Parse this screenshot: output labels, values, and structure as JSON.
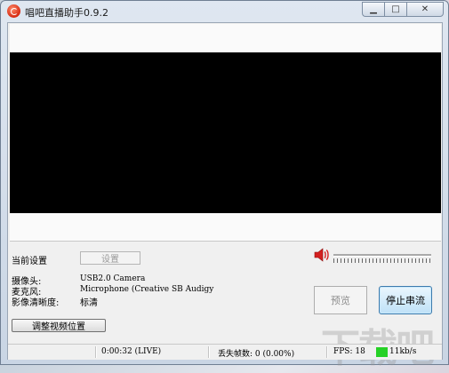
{
  "window": {
    "title": "唱吧直播助手0.9.2",
    "minimize_glyph": "▁",
    "maximize_glyph": "□",
    "close_glyph": "✕"
  },
  "settings": {
    "current_label": "当前设置",
    "settings_button": "设置",
    "camera_label": "摄像头:",
    "camera_value": "USB2.0 Camera",
    "mic_label": "麦克风:",
    "mic_value": "Microphone (Creative SB Audigy",
    "quality_label": "影像清晰度:",
    "quality_value": "标清"
  },
  "volume": {
    "icon": "speaker-icon",
    "level": 0.0
  },
  "buttons": {
    "preview": "预览",
    "stop_stream": "停止串流",
    "adjust_video": "调整视频位置"
  },
  "status": {
    "time": "0:00:32 (LIVE)",
    "dropped_frames": "丢失帧数: 0 (0.00%)",
    "fps": "FPS: 18",
    "bitrate": "11kb/s",
    "indicator_color": "#26d126"
  },
  "watermark": "下载吧"
}
